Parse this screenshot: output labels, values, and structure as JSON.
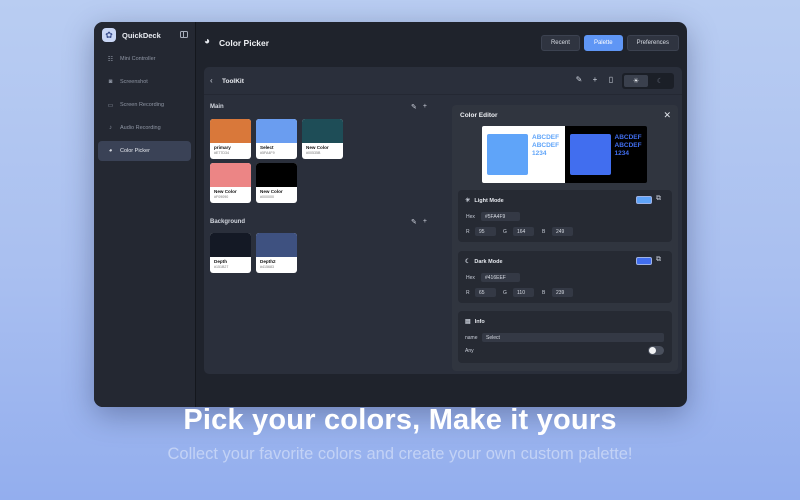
{
  "app": {
    "name": "QuickDeck"
  },
  "sidebar": {
    "items": [
      {
        "label": "Mini Controller",
        "icon": "sliders-icon",
        "active": false
      },
      {
        "label": "Screenshot",
        "icon": "camera-icon",
        "active": false
      },
      {
        "label": "Screen Recording",
        "icon": "video-icon",
        "active": false
      },
      {
        "label": "Audio Recording",
        "icon": "microphone-icon",
        "active": false
      },
      {
        "label": "Color Picker",
        "icon": "palette-icon",
        "active": true
      }
    ]
  },
  "header": {
    "title": "Color Picker",
    "tabs": [
      {
        "label": "Recent",
        "active": false
      },
      {
        "label": "Palette",
        "active": true
      },
      {
        "label": "Preferences",
        "active": false
      }
    ]
  },
  "toolkit": {
    "title": "ToolKit",
    "theme_active": "light"
  },
  "groups": {
    "main": {
      "title": "Main",
      "swatches": [
        {
          "name": "primary",
          "hex": "#E77D34",
          "color": "#d9783a"
        },
        {
          "name": "Select",
          "hex": "#5FA4F9",
          "color": "#6a9df0"
        },
        {
          "name": "New Color",
          "hex": "#00535B",
          "color": "#1e4d57"
        },
        {
          "name": "New Color",
          "hex": "#F09090",
          "color": "#ec8585"
        },
        {
          "name": "New Color",
          "hex": "#000000",
          "color": "#000000"
        }
      ]
    },
    "background": {
      "title": "Background",
      "swatches": [
        {
          "name": "Depth",
          "hex": "#151B27",
          "color": "#141925"
        },
        {
          "name": "Depth2",
          "hex": "#415683",
          "color": "#3e5180"
        }
      ]
    }
  },
  "editor": {
    "title": "Color Editor",
    "preview": {
      "sample_top": "ABCDEF",
      "sample_mid": "ABCDEF",
      "sample_num": "1234",
      "light_bg": "#ffffff",
      "dark_bg": "#000000",
      "light_color": "#5FA4F9",
      "dark_color": "#416EEF"
    },
    "light": {
      "title": "Light Mode",
      "hex_label": "Hex",
      "hex": "#5FA4F9",
      "r_label": "R",
      "r": "95",
      "g_label": "G",
      "g": "164",
      "b_label": "B",
      "b": "249"
    },
    "dark": {
      "title": "Dark Mode",
      "hex_label": "Hex",
      "hex": "#416EEF",
      "r_label": "R",
      "r": "65",
      "g_label": "G",
      "g": "110",
      "b_label": "B",
      "b": "239"
    },
    "info": {
      "title": "Info",
      "name_label": "name",
      "name_value": "Select",
      "any_label": "Any",
      "any_on": false
    }
  },
  "marketing": {
    "headline": "Pick your colors, Make it yours",
    "subline": "Collect your favorite colors and create your own custom palette!"
  }
}
